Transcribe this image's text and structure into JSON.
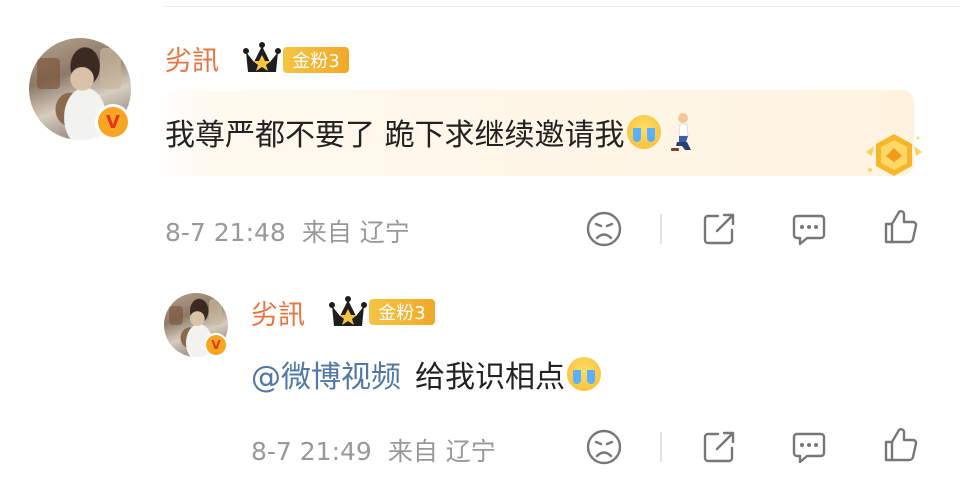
{
  "comments": [
    {
      "username": "劣訊",
      "fan_badge": "金粉3",
      "text": "我尊严都不要了 跪下求继续邀请我",
      "emojis": [
        "loudly-crying-emoji",
        "kneeling-person-emoji"
      ],
      "time": "8-7 21:48",
      "source": "来自 辽宁"
    },
    {
      "username": "劣訊",
      "fan_badge": "金粉3",
      "mention": "@微博视频",
      "text": "给我识相点",
      "emojis": [
        "loudly-crying-emoji"
      ],
      "time": "8-7 21:49",
      "source": "来自 辽宁"
    }
  ],
  "badge_letter": "V",
  "colors": {
    "username": "#eb7340",
    "mention": "#5178a8",
    "meta": "#999999",
    "fan_badge": "#f0a82a"
  },
  "icons": [
    "sad-face-icon",
    "share-icon",
    "comment-icon",
    "like-icon",
    "crown-icon",
    "verified-v-icon",
    "honor-badge-icon"
  ]
}
